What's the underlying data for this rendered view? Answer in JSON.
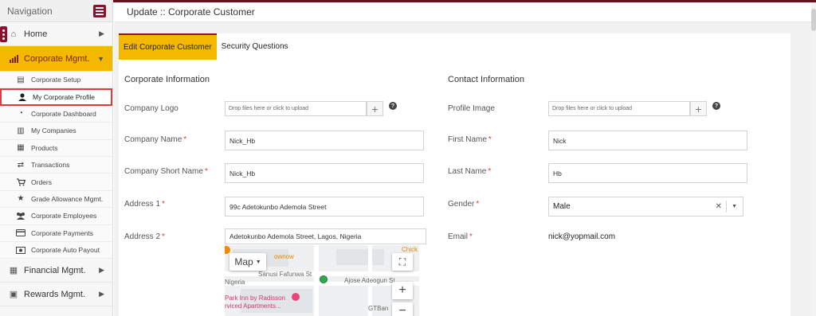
{
  "sidebar": {
    "title": "Navigation",
    "items": [
      {
        "label": "Home",
        "icon": "home-icon"
      },
      {
        "label": "Corporate Mgmt.",
        "icon": "chart-icon"
      },
      {
        "label": "Financial Mgmt.",
        "icon": "financial-icon"
      },
      {
        "label": "Rewards Mgmt.",
        "icon": "rewards-icon"
      }
    ],
    "subitems": [
      {
        "label": "Corporate Setup",
        "icon": "setup-icon"
      },
      {
        "label": "My Corporate Profile",
        "icon": "user-icon"
      },
      {
        "label": "Corporate Dashboard",
        "icon": "dashboard-icon"
      },
      {
        "label": "My Companies",
        "icon": "companies-icon"
      },
      {
        "label": "Products",
        "icon": "products-icon"
      },
      {
        "label": "Transactions",
        "icon": "transactions-icon"
      },
      {
        "label": "Orders",
        "icon": "cart-icon"
      },
      {
        "label": "Grade Allowance Mgmt.",
        "icon": "star-icon"
      },
      {
        "label": "Corporate Employees",
        "icon": "employees-icon"
      },
      {
        "label": "Corporate Payments",
        "icon": "card-icon"
      },
      {
        "label": "Corporate Auto Payout",
        "icon": "payout-icon"
      }
    ]
  },
  "header": {
    "title": "Update :: Corporate Customer"
  },
  "tabs": [
    {
      "label": "Edit Corporate Customer"
    },
    {
      "label": "Security Questions"
    }
  ],
  "corporate": {
    "section_title": "Corporate Information",
    "logo_label": "Company Logo",
    "upload_placeholder": "Drop files here or click to upload",
    "company_name_label": "Company Name",
    "company_name": "Nick_Hb",
    "short_name_label": "Company Short Name",
    "short_name": "Nick_Hb",
    "address1_label": "Address 1",
    "address1": "99c Adetokunbo Ademola Street",
    "address2_label": "Address 2",
    "address2": "Adetokunbo Ademola Street, Lagos, Nigeria"
  },
  "contact": {
    "section_title": "Contact Information",
    "profile_image_label": "Profile Image",
    "upload_placeholder": "Drop files here or click to upload",
    "first_name_label": "First Name",
    "first_name": "Nick",
    "last_name_label": "Last Name",
    "last_name": "Hb",
    "gender_label": "Gender",
    "gender": "Male",
    "email_label": "Email",
    "email": "nick@yopmail.com"
  },
  "map": {
    "type_label": "Map",
    "texts": [
      "Sanusi Fafunwa St",
      "Nigeria",
      "Park Inn by Radisson",
      "rviced Apartments...",
      "Ajose Adeogun St",
      "GTBan",
      "ownow",
      "Chick"
    ]
  },
  "colors": {
    "accent": "#f5b800",
    "brand": "#8a1230",
    "required": "#e23b3b"
  }
}
